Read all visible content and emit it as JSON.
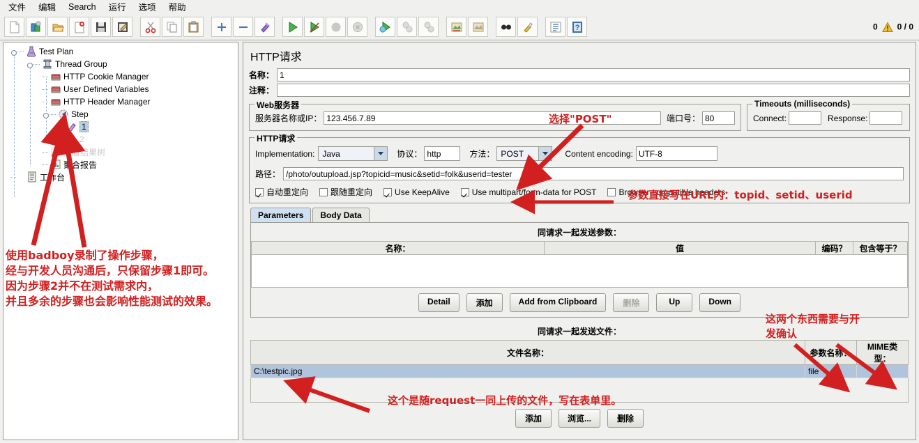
{
  "menubar": {
    "items": [
      {
        "label": "文件",
        "name": "menu-file"
      },
      {
        "label": "编辑",
        "name": "menu-edit"
      },
      {
        "label": "Search",
        "name": "menu-search"
      },
      {
        "label": "运行",
        "name": "menu-run"
      },
      {
        "label": "选项",
        "name": "menu-options"
      },
      {
        "label": "帮助",
        "name": "menu-help"
      }
    ]
  },
  "toolbar": {
    "icons": [
      "new-icon",
      "templates-icon",
      "open-icon",
      "close-icon",
      "save-icon",
      "save-as-icon",
      "cut-icon",
      "copy-icon",
      "paste-icon",
      "expand-icon",
      "collapse-icon",
      "toggle-icon",
      "start-icon",
      "start-no-timers-icon",
      "stop-icon",
      "shutdown-icon",
      "start-remote-icon",
      "stop-remote-icon",
      "shutdown-remote-icon",
      "clear-icon",
      "clear-all-icon",
      "search-icon",
      "search-reset-icon",
      "function-helper-icon",
      "help-icon"
    ],
    "error_count": "0",
    "warn_icon": "warning-triangle-icon",
    "thread_counter": "0 / 0"
  },
  "tree": {
    "nodes": [
      {
        "label": "Test Plan",
        "icon": "test-plan-icon",
        "depth": 0,
        "name": "tree-node-test-plan"
      },
      {
        "label": "Thread Group",
        "icon": "thread-group-icon",
        "depth": 1,
        "name": "tree-node-thread-group"
      },
      {
        "label": "HTTP Cookie Manager",
        "icon": "cookie-manager-icon",
        "depth": 2,
        "name": "tree-node-http-cookie-manager"
      },
      {
        "label": "User Defined Variables",
        "icon": "user-defined-variables-icon",
        "depth": 2,
        "name": "tree-node-user-defined-variables"
      },
      {
        "label": "HTTP Header Manager",
        "icon": "header-manager-icon",
        "depth": 2,
        "name": "tree-node-http-header-manager"
      },
      {
        "label": "Step",
        "icon": "controller-icon",
        "depth": 2,
        "name": "tree-node-step"
      },
      {
        "label": "1",
        "icon": "http-sampler-icon",
        "depth": 3,
        "name": "tree-node-sampler-1",
        "selected": true
      },
      {
        "label": "2",
        "icon": "http-sampler-icon",
        "depth": 3,
        "name": "tree-node-sampler-2",
        "disabled": true
      },
      {
        "label": "察看结果树",
        "icon": "view-results-tree-icon",
        "depth": 2,
        "name": "tree-node-view-results-tree",
        "disabled": true
      },
      {
        "label": "聚合报告",
        "icon": "aggregate-report-icon",
        "depth": 2,
        "name": "tree-node-aggregate-report"
      },
      {
        "label": "工作台",
        "icon": "workbench-icon",
        "depth": 0,
        "name": "tree-node-workbench"
      }
    ]
  },
  "request": {
    "title": "HTTP请求",
    "name_label": "名称：",
    "name_value": "1",
    "comment_label": "注释：",
    "comment_value": "",
    "webserver": {
      "title": "Web服务器",
      "host_label": "服务器名称或IP：",
      "host_value": "123.456.7.89",
      "port_label": "端口号：",
      "port_value": "80"
    },
    "timeouts": {
      "title": "Timeouts (milliseconds)",
      "connect_label": "Connect:",
      "connect_value": "",
      "response_label": "Response:",
      "response_value": ""
    },
    "http": {
      "title": "HTTP请求",
      "implementation_label": "Implementation:",
      "implementation_value": "Java",
      "protocol_label": "协议：",
      "protocol_value": "http",
      "method_label": "方法：",
      "method_value": "POST",
      "encoding_label": "Content encoding:",
      "encoding_value": "UTF-8",
      "path_label": "路径：",
      "path_value": "/photo/outupload.jsp?topicid=music&setid=folk&userid=tester",
      "checkboxes": [
        {
          "label": "自动重定向",
          "checked": true,
          "name": "checkbox-follow-redirects-auto"
        },
        {
          "label": "跟随重定向",
          "checked": false,
          "name": "checkbox-follow-redirects"
        },
        {
          "label": "Use KeepAlive",
          "checked": true,
          "name": "checkbox-use-keepalive"
        },
        {
          "label": "Use multipart/form-data for POST",
          "checked": true,
          "name": "checkbox-use-multipart"
        },
        {
          "label": "Browser-compatible headers",
          "checked": false,
          "name": "checkbox-browser-compatible-headers"
        }
      ]
    },
    "tabs": [
      {
        "label": "Parameters",
        "active": true,
        "name": "tab-parameters"
      },
      {
        "label": "Body Data",
        "active": false,
        "name": "tab-body-data"
      }
    ],
    "params_table": {
      "caption": "同请求一起发送参数：",
      "columns": [
        "名称：",
        "值",
        "编码？",
        "包含等于？"
      ],
      "rows": []
    },
    "params_buttons": [
      {
        "label": "Detail",
        "name": "detail-button",
        "disabled": false
      },
      {
        "label": "添加",
        "name": "add-param-button",
        "disabled": false
      },
      {
        "label": "Add from Clipboard",
        "name": "add-from-clipboard-button",
        "disabled": false
      },
      {
        "label": "删除",
        "name": "delete-param-button",
        "disabled": true
      },
      {
        "label": "Up",
        "name": "move-up-button",
        "disabled": false
      },
      {
        "label": "Down",
        "name": "move-down-button",
        "disabled": false
      }
    ],
    "files_table": {
      "caption": "同请求一起发送文件：",
      "columns": [
        "文件名称：",
        "参数名称：",
        "MIME类型："
      ],
      "rows": [
        {
          "file": "C:\\testpic.jpg",
          "param": "file",
          "mime": "",
          "selected": true
        }
      ]
    },
    "files_buttons": [
      {
        "label": "添加",
        "name": "add-file-button"
      },
      {
        "label": "浏览...",
        "name": "browse-file-button"
      },
      {
        "label": "删除",
        "name": "delete-file-button"
      }
    ]
  },
  "annotations": {
    "color": "#d21f1f",
    "tree_note": "使用badboy录制了操作步骤，\n经与开发人员沟通后，只保留步骤1即可。\n因为步骤2并不在测试需求内，\n并且多余的步骤也会影响性能测试的效果。",
    "method_note": "选择\"POST\"",
    "url_note": "参数直接写在URL内：topid、setid、userid",
    "columns_note": "这两个东西需要与开\n发确认",
    "file_note": "这个是随request一同上传的文件，写在表单里。"
  }
}
